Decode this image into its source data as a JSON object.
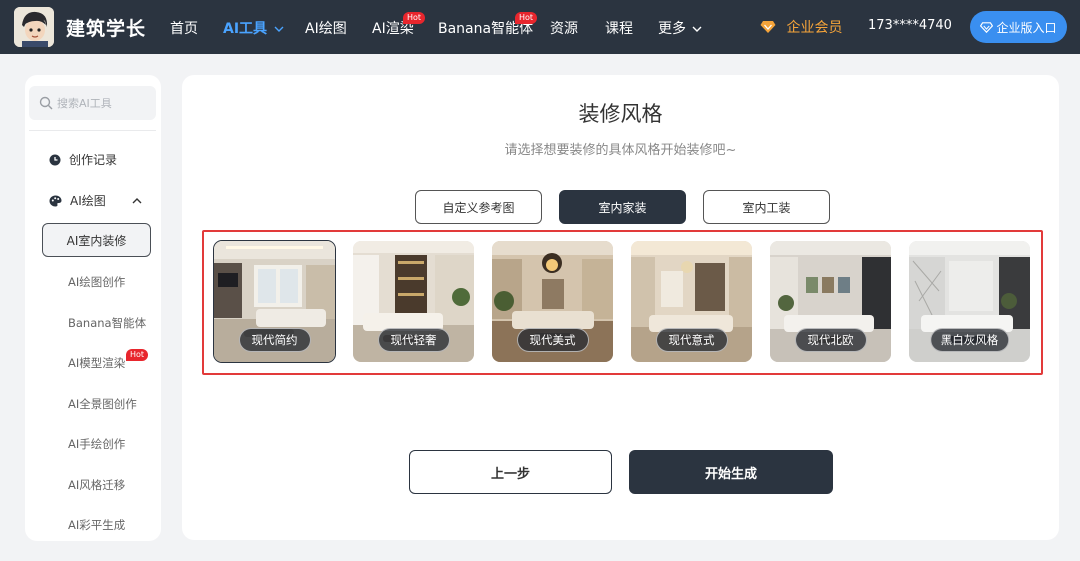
{
  "header": {
    "brand": "建筑学长",
    "nav": [
      {
        "label": "首页"
      },
      {
        "label": "AI工具"
      },
      {
        "label": "AI绘图"
      },
      {
        "label": "AI渲染",
        "badge": "Hot"
      },
      {
        "label": "Banana智能体",
        "badge": "Hot"
      },
      {
        "label": "资源"
      },
      {
        "label": "课程"
      },
      {
        "label": "更多"
      }
    ],
    "member_label": "企业会员",
    "phone": "173****4740",
    "enterprise_button": "企业版入口"
  },
  "sidebar": {
    "search_placeholder": "搜索AI工具",
    "history_label": "创作记录",
    "group_label": "AI绘图",
    "items": [
      {
        "label": "AI室内装修"
      },
      {
        "label": "AI绘图创作"
      },
      {
        "label": "Banana智能体"
      },
      {
        "label": "AI模型渲染",
        "badge": "Hot"
      },
      {
        "label": "AI全景图创作"
      },
      {
        "label": "AI手绘创作"
      },
      {
        "label": "AI风格迁移"
      },
      {
        "label": "AI彩平生成"
      }
    ]
  },
  "main": {
    "title": "装修风格",
    "subtitle": "请选择想要装修的具体风格开始装修吧~",
    "tabs": [
      {
        "label": "自定义参考图"
      },
      {
        "label": "室内家装"
      },
      {
        "label": "室内工装"
      }
    ],
    "selected_tab": "室内家装",
    "styles": [
      {
        "label": "现代简约"
      },
      {
        "label": "现代轻奢"
      },
      {
        "label": "现代美式"
      },
      {
        "label": "现代意式"
      },
      {
        "label": "现代北欧"
      },
      {
        "label": "黑白灰风格"
      }
    ],
    "selected_style": "现代简约",
    "prev_button": "上一步",
    "start_button": "开始生成"
  },
  "colors": {
    "topbar": "#2b3440",
    "nav_active": "#4aa3ff",
    "member": "#f5a43a",
    "enterprise_button": "#3a8ff0",
    "hot_badge": "#e8262d",
    "highlight_border": "#e23a3a"
  }
}
